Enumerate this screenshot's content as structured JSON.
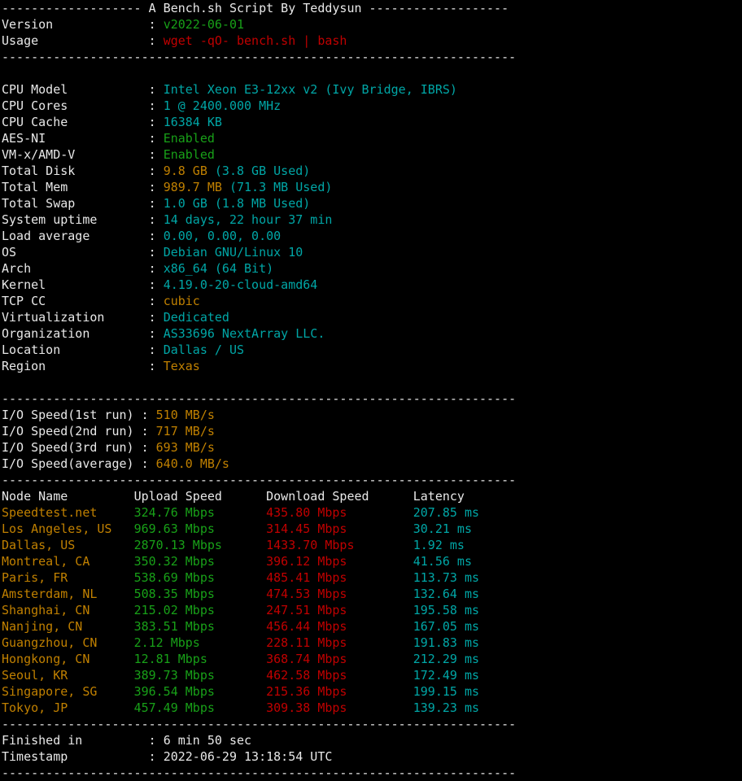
{
  "terminal": {
    "title_line": "------------------- A Bench.sh Script By Teddysun -------------------",
    "separator": "----------------------------------------------------------------------",
    "colors": {
      "background": "#000000",
      "white": "#e8e8e8",
      "cyan": "#00a6a6",
      "green": "#18a018",
      "red": "#c00000",
      "orange": "#c08000"
    }
  },
  "script_info": {
    "rows": [
      {
        "label": "Version",
        "sep": ":",
        "value": "v2022-06-01",
        "color": "gr"
      },
      {
        "label": "Usage",
        "sep": ":",
        "value": "wget -qO- bench.sh | bash",
        "color": "rd"
      }
    ]
  },
  "system_info": {
    "rows": [
      {
        "label": "CPU Model",
        "sep": ":",
        "value": "Intel Xeon E3-12xx v2 (Ivy Bridge, IBRS)",
        "color": "cy"
      },
      {
        "label": "CPU Cores",
        "sep": ":",
        "value": "1 @ 2400.000 MHz",
        "color": "cy"
      },
      {
        "label": "CPU Cache",
        "sep": ":",
        "value": "16384 KB",
        "color": "cy"
      },
      {
        "label": "AES-NI",
        "sep": ":",
        "value": "Enabled",
        "color": "gr"
      },
      {
        "label": "VM-x/AMD-V",
        "sep": ":",
        "value": "Enabled",
        "color": "gr"
      },
      {
        "label": "Total Disk",
        "sep": ":",
        "value": "9.8 GB",
        "color": "or",
        "value2": " (3.8 GB Used)",
        "color2": "cy"
      },
      {
        "label": "Total Mem",
        "sep": ":",
        "value": "989.7 MB",
        "color": "or",
        "value2": " (71.3 MB Used)",
        "color2": "cy"
      },
      {
        "label": "Total Swap",
        "sep": ":",
        "value": "1.0 GB (1.8 MB Used)",
        "color": "cy"
      },
      {
        "label": "System uptime",
        "sep": ":",
        "value": "14 days, 22 hour 37 min",
        "color": "cy"
      },
      {
        "label": "Load average",
        "sep": ":",
        "value": "0.00, 0.00, 0.00",
        "color": "cy"
      },
      {
        "label": "OS",
        "sep": ":",
        "value": "Debian GNU/Linux 10",
        "color": "cy"
      },
      {
        "label": "Arch",
        "sep": ":",
        "value": "x86_64 (64 Bit)",
        "color": "cy"
      },
      {
        "label": "Kernel",
        "sep": ":",
        "value": "4.19.0-20-cloud-amd64",
        "color": "cy"
      },
      {
        "label": "TCP CC",
        "sep": ":",
        "value": "cubic",
        "color": "or"
      },
      {
        "label": "Virtualization",
        "sep": ":",
        "value": "Dedicated",
        "color": "cy"
      },
      {
        "label": "Organization",
        "sep": ":",
        "value": "AS33696 NextArray LLC.",
        "color": "cy"
      },
      {
        "label": "Location",
        "sep": ":",
        "value": "Dallas / US",
        "color": "cy"
      },
      {
        "label": "Region",
        "sep": ":",
        "value": "Texas",
        "color": "or"
      }
    ]
  },
  "io_speed": {
    "rows": [
      {
        "label": "I/O Speed(1st run)",
        "sep": ":",
        "value": "510 MB/s",
        "color": "or"
      },
      {
        "label": "I/O Speed(2nd run)",
        "sep": ":",
        "value": "717 MB/s",
        "color": "or"
      },
      {
        "label": "I/O Speed(3rd run)",
        "sep": ":",
        "value": "693 MB/s",
        "color": "or"
      },
      {
        "label": "I/O Speed(average)",
        "sep": ":",
        "value": "640.0 MB/s",
        "color": "or"
      }
    ]
  },
  "speedtest": {
    "headers": [
      "Node Name",
      "Upload Speed",
      "Download Speed",
      "Latency"
    ],
    "rows": [
      {
        "node": "Speedtest.net",
        "upload": "324.76 Mbps",
        "download": "435.80 Mbps",
        "latency": "207.85 ms"
      },
      {
        "node": "Los Angeles, US",
        "upload": "969.63 Mbps",
        "download": "314.45 Mbps",
        "latency": "30.21 ms"
      },
      {
        "node": "Dallas, US",
        "upload": "2870.13 Mbps",
        "download": "1433.70 Mbps",
        "latency": "1.92 ms"
      },
      {
        "node": "Montreal, CA",
        "upload": "350.32 Mbps",
        "download": "396.12 Mbps",
        "latency": "41.56 ms"
      },
      {
        "node": "Paris, FR",
        "upload": "538.69 Mbps",
        "download": "485.41 Mbps",
        "latency": "113.73 ms"
      },
      {
        "node": "Amsterdam, NL",
        "upload": "508.35 Mbps",
        "download": "474.53 Mbps",
        "latency": "132.64 ms"
      },
      {
        "node": "Shanghai, CN",
        "upload": "215.02 Mbps",
        "download": "247.51 Mbps",
        "latency": "195.58 ms"
      },
      {
        "node": "Nanjing, CN",
        "upload": "383.51 Mbps",
        "download": "456.44 Mbps",
        "latency": "167.05 ms"
      },
      {
        "node": "Guangzhou, CN",
        "upload": "2.12 Mbps",
        "download": "228.11 Mbps",
        "latency": "191.83 ms"
      },
      {
        "node": "Hongkong, CN",
        "upload": "12.81 Mbps",
        "download": "368.74 Mbps",
        "latency": "212.29 ms"
      },
      {
        "node": "Seoul, KR",
        "upload": "389.73 Mbps",
        "download": "462.58 Mbps",
        "latency": "172.49 ms"
      },
      {
        "node": "Singapore, SG",
        "upload": "396.54 Mbps",
        "download": "215.36 Mbps",
        "latency": "199.15 ms"
      },
      {
        "node": "Tokyo, JP",
        "upload": "457.49 Mbps",
        "download": "309.38 Mbps",
        "latency": "139.23 ms"
      }
    ]
  },
  "footer": {
    "rows": [
      {
        "label": "Finished in",
        "sep": ":",
        "value": "6 min 50 sec",
        "color": "w"
      },
      {
        "label": "Timestamp",
        "sep": ":",
        "value": "2022-06-29 13:18:54 UTC",
        "color": "w"
      }
    ]
  }
}
